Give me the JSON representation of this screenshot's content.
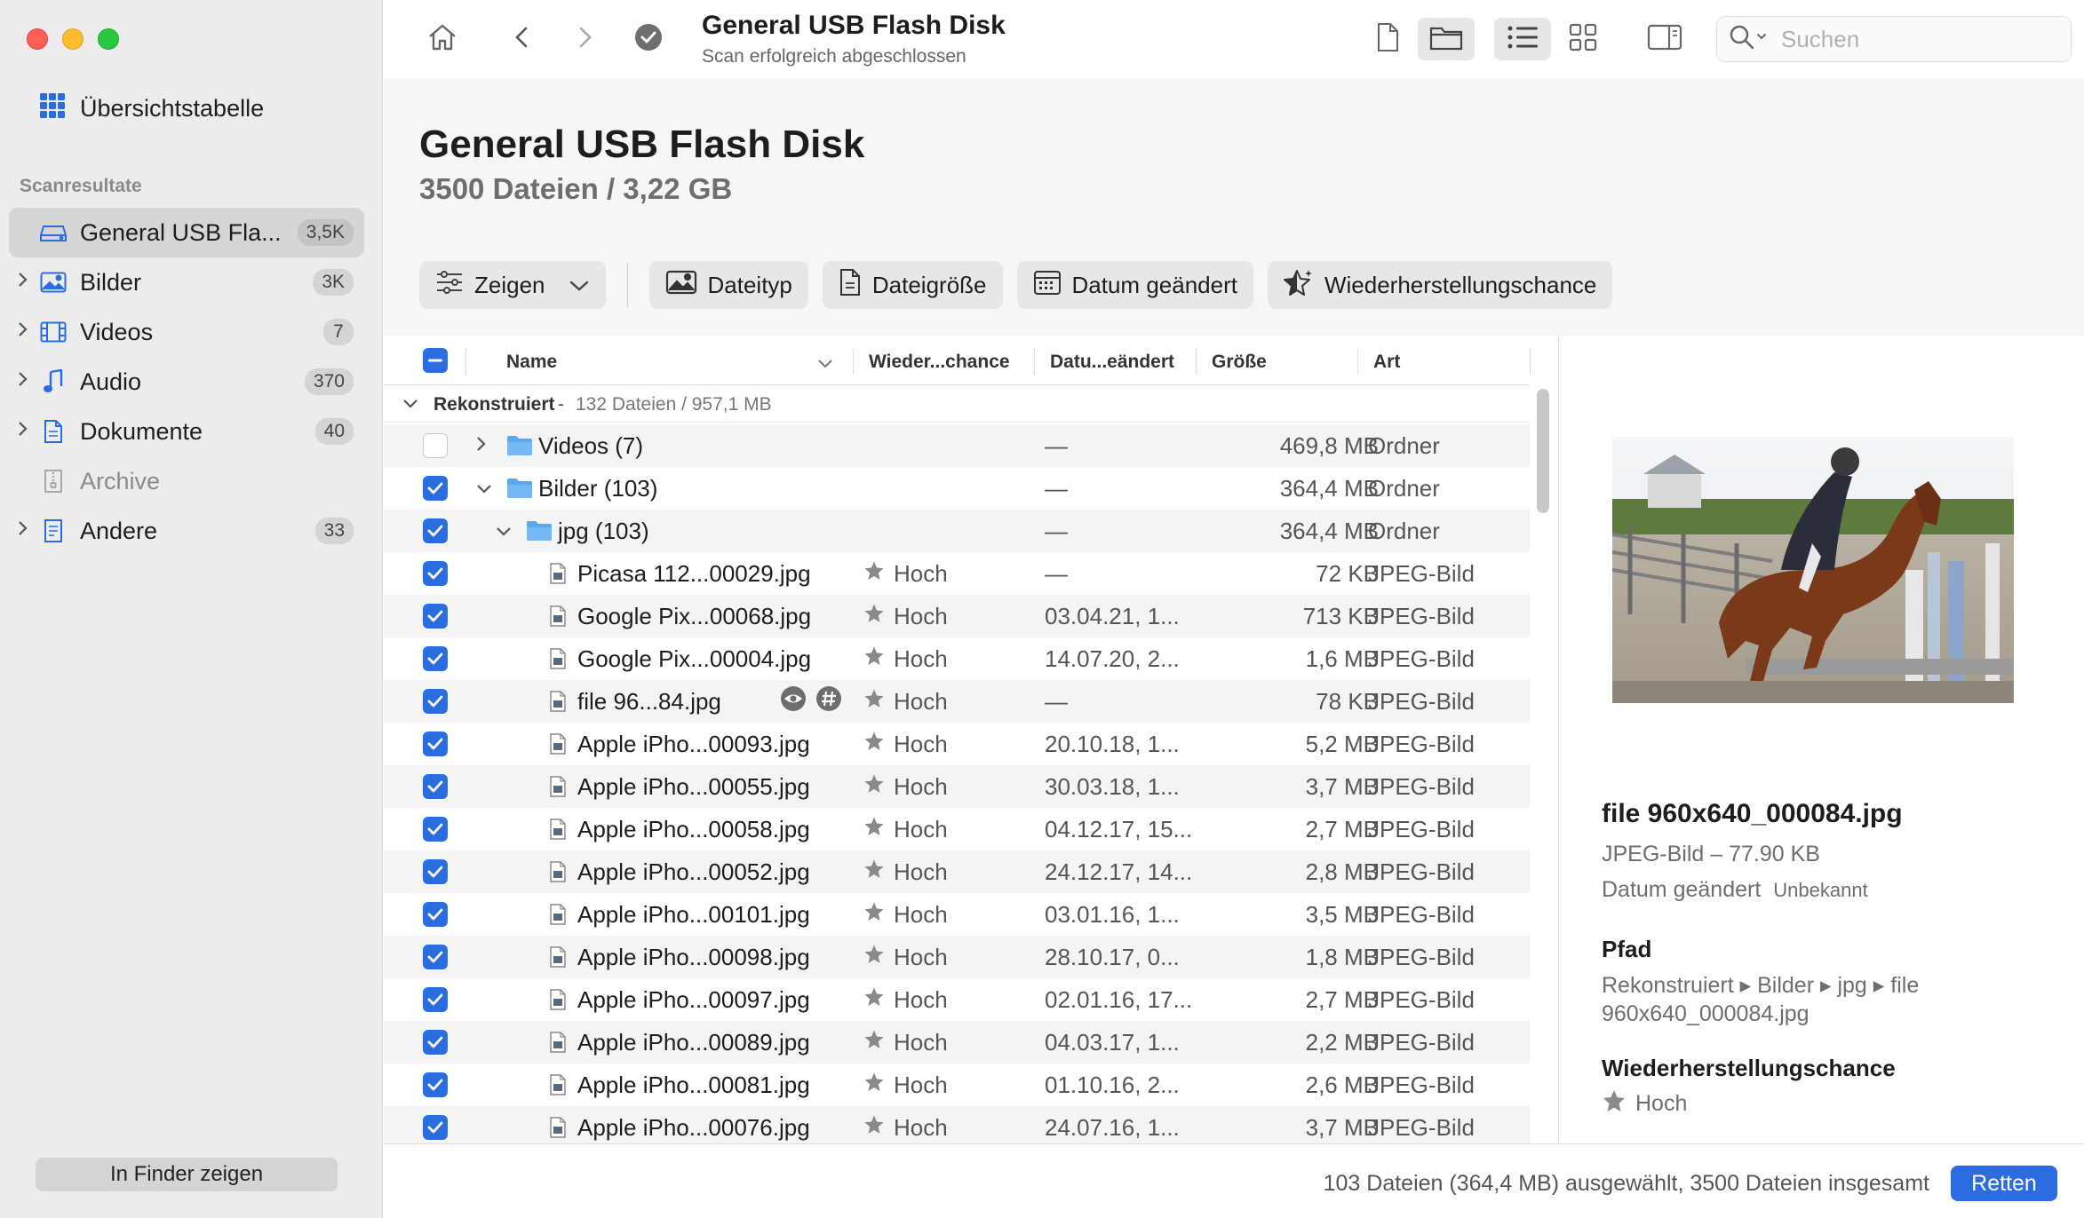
{
  "sidebar": {
    "overview_label": "Übersichtstabelle",
    "section_label": "Scanresultate",
    "items": [
      {
        "label": "General USB Fla...",
        "count": "3,5K",
        "icon": "drive-icon",
        "active": true,
        "chevron": false
      },
      {
        "label": "Bilder",
        "count": "3K",
        "icon": "image-icon",
        "chevron": true
      },
      {
        "label": "Videos",
        "count": "7",
        "icon": "film-icon",
        "chevron": true
      },
      {
        "label": "Audio",
        "count": "370",
        "icon": "music-note-icon",
        "chevron": true
      },
      {
        "label": "Dokumente",
        "count": "40",
        "icon": "document-icon",
        "chevron": true
      },
      {
        "label": "Archive",
        "count": "",
        "icon": "archive-icon",
        "chevron": false,
        "dim": true
      },
      {
        "label": "Andere",
        "count": "33",
        "icon": "other-file-icon",
        "chevron": true
      }
    ],
    "finder_button": "In Finder zeigen"
  },
  "toolbar": {
    "title": "General USB Flash Disk",
    "subtitle": "Scan erfolgreich abgeschlossen",
    "search_placeholder": "Suchen"
  },
  "header": {
    "title": "General USB Flash Disk",
    "subtitle": "3500 Dateien / 3,22 GB"
  },
  "filters": {
    "show": "Zeigen",
    "filetype": "Dateityp",
    "filesize": "Dateigröße",
    "date_modified": "Datum geändert",
    "recovery_chance": "Wiederherstellungschance"
  },
  "table": {
    "columns": {
      "name": "Name",
      "chance": "Wieder...chance",
      "date": "Datu...eändert",
      "size": "Größe",
      "kind": "Art"
    },
    "group": {
      "label": "Rekonstruiert",
      "info": "132 Dateien / 957,1 MB"
    },
    "rows": [
      {
        "name": "Videos (7)",
        "level": 0,
        "type": "folder",
        "chevron": "right",
        "checked": false,
        "chance": "",
        "date": "—",
        "size": "469,8 MB",
        "kind": "Ordner"
      },
      {
        "name": "Bilder (103)",
        "level": 0,
        "type": "folder",
        "chevron": "down",
        "checked": true,
        "chance": "",
        "date": "—",
        "size": "364,4 MB",
        "kind": "Ordner"
      },
      {
        "name": "jpg (103)",
        "level": 1,
        "type": "folder",
        "chevron": "down",
        "checked": true,
        "chance": "",
        "date": "—",
        "size": "364,4 MB",
        "kind": "Ordner"
      },
      {
        "name": "Picasa 112...00029.jpg",
        "level": 2,
        "type": "file",
        "checked": true,
        "chance": "Hoch",
        "date": "—",
        "size": "72 KB",
        "kind": "JPEG-Bild"
      },
      {
        "name": "Google Pix...00068.jpg",
        "level": 2,
        "type": "file",
        "checked": true,
        "chance": "Hoch",
        "date": "03.04.21, 1...",
        "size": "713 KB",
        "kind": "JPEG-Bild"
      },
      {
        "name": "Google Pix...00004.jpg",
        "level": 2,
        "type": "file",
        "checked": true,
        "chance": "Hoch",
        "date": "14.07.20, 2...",
        "size": "1,6 MB",
        "kind": "JPEG-Bild"
      },
      {
        "name": "file 96...84.jpg",
        "level": 2,
        "type": "file",
        "checked": true,
        "chance": "Hoch",
        "date": "—",
        "size": "78 KB",
        "kind": "JPEG-Bild",
        "extras": true
      },
      {
        "name": "Apple iPho...00093.jpg",
        "level": 2,
        "type": "file",
        "checked": true,
        "chance": "Hoch",
        "date": "20.10.18, 1...",
        "size": "5,2 MB",
        "kind": "JPEG-Bild"
      },
      {
        "name": "Apple iPho...00055.jpg",
        "level": 2,
        "type": "file",
        "checked": true,
        "chance": "Hoch",
        "date": "30.03.18, 1...",
        "size": "3,7 MB",
        "kind": "JPEG-Bild"
      },
      {
        "name": "Apple iPho...00058.jpg",
        "level": 2,
        "type": "file",
        "checked": true,
        "chance": "Hoch",
        "date": "04.12.17, 15...",
        "size": "2,7 MB",
        "kind": "JPEG-Bild"
      },
      {
        "name": "Apple iPho...00052.jpg",
        "level": 2,
        "type": "file",
        "checked": true,
        "chance": "Hoch",
        "date": "24.12.17, 14...",
        "size": "2,8 MB",
        "kind": "JPEG-Bild"
      },
      {
        "name": "Apple iPho...00101.jpg",
        "level": 2,
        "type": "file",
        "checked": true,
        "chance": "Hoch",
        "date": "03.01.16, 1...",
        "size": "3,5 MB",
        "kind": "JPEG-Bild"
      },
      {
        "name": "Apple iPho...00098.jpg",
        "level": 2,
        "type": "file",
        "checked": true,
        "chance": "Hoch",
        "date": "28.10.17, 0...",
        "size": "1,8 MB",
        "kind": "JPEG-Bild"
      },
      {
        "name": "Apple iPho...00097.jpg",
        "level": 2,
        "type": "file",
        "checked": true,
        "chance": "Hoch",
        "date": "02.01.16, 17...",
        "size": "2,7 MB",
        "kind": "JPEG-Bild"
      },
      {
        "name": "Apple iPho...00089.jpg",
        "level": 2,
        "type": "file",
        "checked": true,
        "chance": "Hoch",
        "date": "04.03.17, 1...",
        "size": "2,2 MB",
        "kind": "JPEG-Bild"
      },
      {
        "name": "Apple iPho...00081.jpg",
        "level": 2,
        "type": "file",
        "checked": true,
        "chance": "Hoch",
        "date": "01.10.16, 2...",
        "size": "2,6 MB",
        "kind": "JPEG-Bild"
      },
      {
        "name": "Apple iPho...00076.jpg",
        "level": 2,
        "type": "file",
        "checked": true,
        "chance": "Hoch",
        "date": "24.07.16, 1...",
        "size": "3,7 MB",
        "kind": "JPEG-Bild"
      }
    ]
  },
  "preview": {
    "filename": "file 960x640_000084.jpg",
    "type_size": "JPEG-Bild – 77.90 KB",
    "date_label": "Datum geändert",
    "date_value": "Unbekannt",
    "path_heading": "Pfad",
    "path": "Rekonstruiert ▸ Bilder ▸ jpg ▸ file 960x640_000084.jpg",
    "chance_heading": "Wiederherstellungschance",
    "chance_value": "Hoch"
  },
  "footer": {
    "status": "103 Dateien (364,4 MB) ausgewählt, 3500 Dateien insgesamt",
    "recover_button": "Retten"
  },
  "colors": {
    "accent": "#2b6de0",
    "folder": "#5aa9f0"
  }
}
